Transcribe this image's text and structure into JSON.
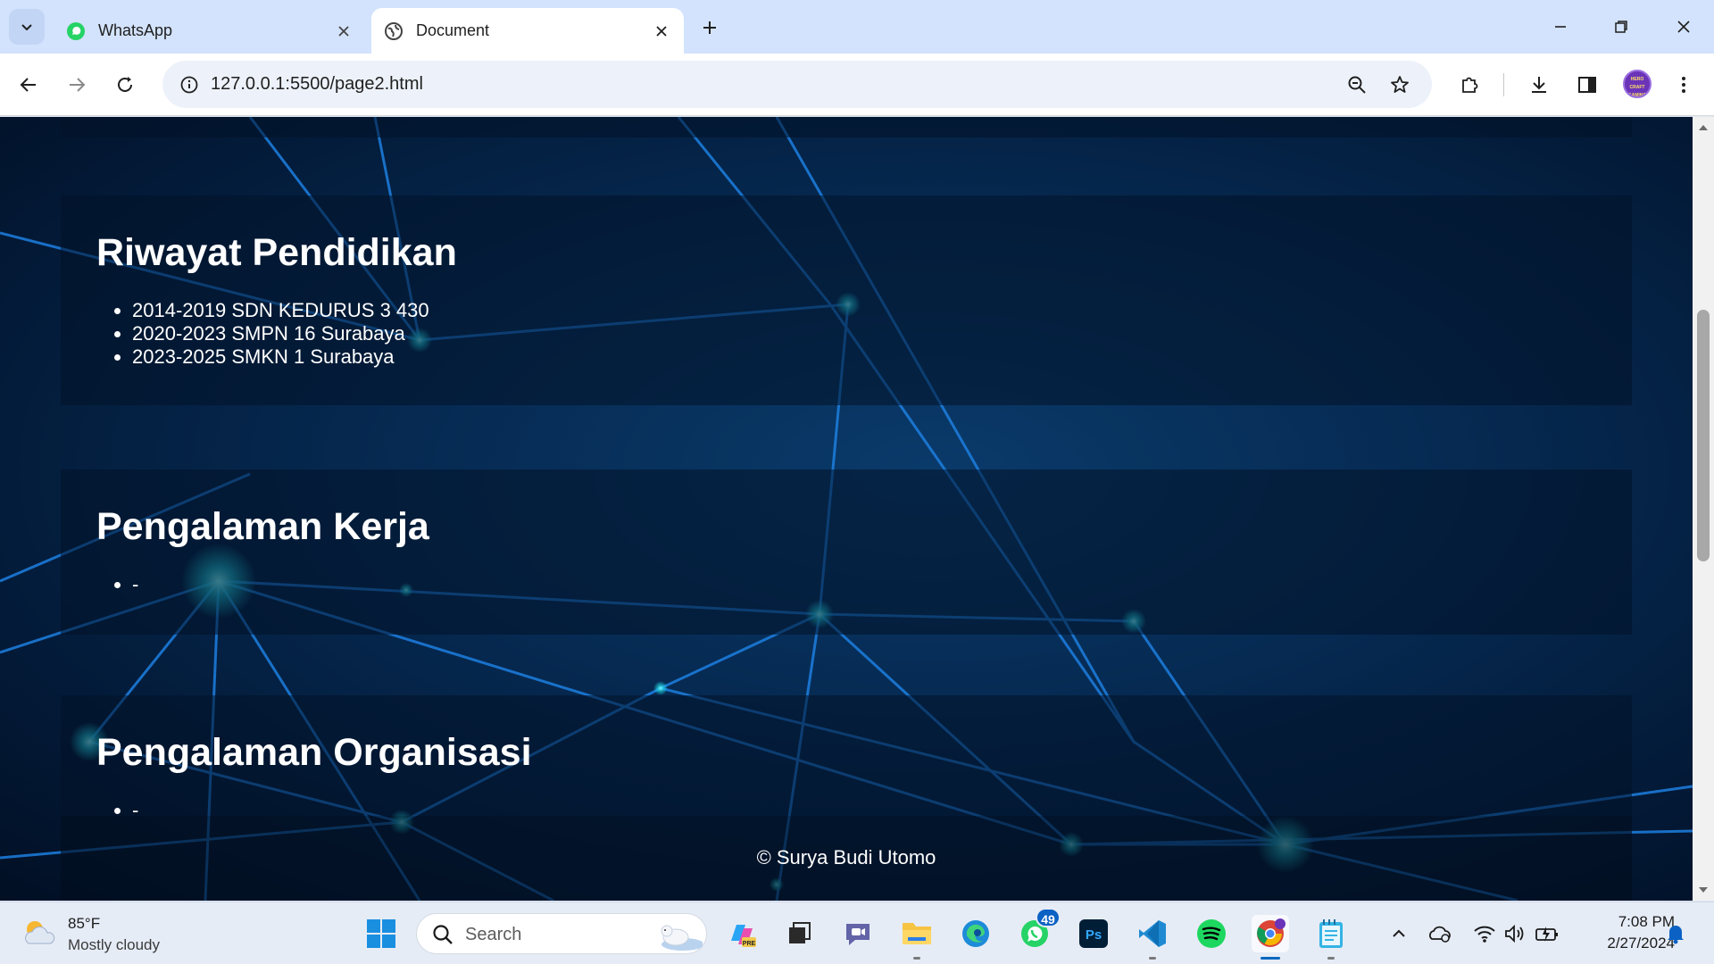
{
  "browser": {
    "tabs": [
      {
        "title": "WhatsApp",
        "icon": "whatsapp-icon",
        "active": false
      },
      {
        "title": "Document",
        "icon": "globe-icon",
        "active": true
      }
    ],
    "url": "127.0.0.1:5500/page2.html",
    "profile_text": "HERO CRAFT GAMING"
  },
  "page": {
    "sections": [
      {
        "title": "Riwayat Pendidikan",
        "items": [
          "2014-2019 SDN KEDURUS 3 430",
          "2020-2023 SMPN 16 Surabaya",
          "2023-2025 SMKN 1 Surabaya"
        ]
      },
      {
        "title": "Pengalaman Kerja",
        "items": [
          "-"
        ]
      },
      {
        "title": "Pengalaman Organisasi",
        "items": [
          "-"
        ]
      }
    ],
    "footer": "© Surya Budi Utomo"
  },
  "taskbar": {
    "weather": {
      "temp": "85°F",
      "desc": "Mostly cloudy"
    },
    "search_placeholder": "Search",
    "whatsapp_badge": "49",
    "apps": [
      "windows-start-icon",
      "search",
      "copilot-icon",
      "task-view-icon",
      "teams-chat-icon",
      "file-explorer-icon",
      "edge-icon",
      "whatsapp-icon",
      "photoshop-icon",
      "vscode-icon",
      "spotify-icon",
      "chrome-icon",
      "notepad-icon"
    ],
    "time": "7:08 PM",
    "date": "2/27/2024"
  },
  "colors": {
    "page_bg": "#031a38",
    "accent": "#0067c0",
    "tabstrip": "#d3e3fd"
  }
}
